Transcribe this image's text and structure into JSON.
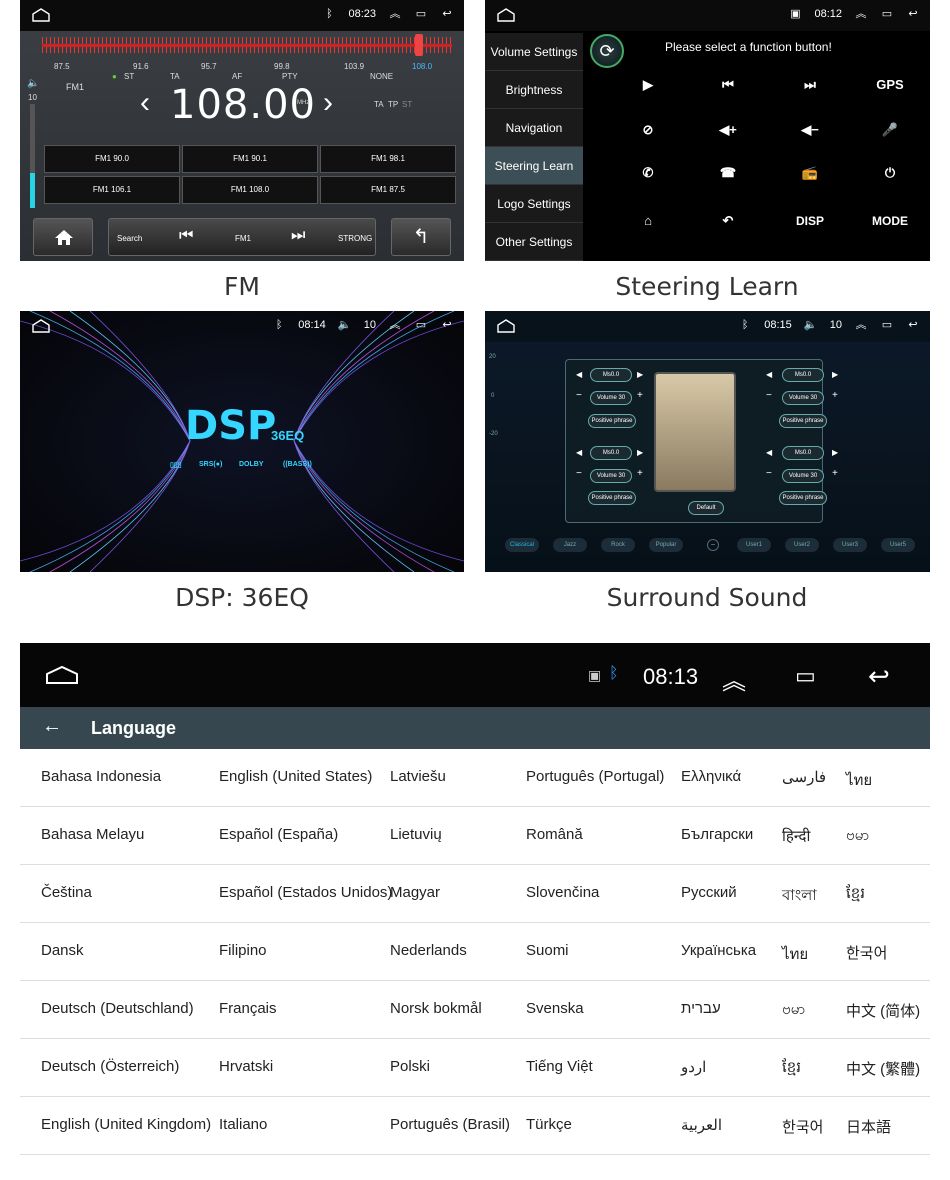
{
  "fm": {
    "time": "08:23",
    "scale_labels": [
      "87.5",
      "91.6",
      "95.7",
      "99.8",
      "103.9",
      "108.0"
    ],
    "indicators": [
      "ST",
      "TA",
      "AF",
      "PTY",
      "NONE"
    ],
    "band": "FM1",
    "volume": "10",
    "frequency": "108.00",
    "unit": "MHz",
    "ta_tp_st": [
      "TA",
      "TP",
      "ST"
    ],
    "presets": [
      "FM1 90.0",
      "FM1 90.1",
      "FM1 98.1",
      "FM1 106.1",
      "FM1 108.0",
      "FM1 87.5"
    ],
    "search_label": "Search",
    "band_label": "FM1",
    "strength_label": "STRONG",
    "caption": "FM"
  },
  "steer": {
    "time": "08:12",
    "prompt": "Please select a function button!",
    "menu": [
      "Volume Settings",
      "Brightness",
      "Navigation",
      "Steering Learn",
      "Logo Settings",
      "Other Settings"
    ],
    "selected": "Steering Learn",
    "text_buttons": {
      "gps": "GPS",
      "disp": "DISP",
      "mode": "MODE"
    },
    "caption": "Steering Learn"
  },
  "dsp": {
    "time": "08:14",
    "volume": "10",
    "title": "DSP",
    "subtitle": "36EQ",
    "badges": [
      "SRS(●)",
      "DOLBY",
      "((BASS))"
    ],
    "caption": "DSP: 36EQ"
  },
  "surround": {
    "time": "08:15",
    "volume": "10",
    "ms_label": "Ms0.0",
    "volume_label": "Volume 30",
    "phrase_label": "Positive phrase",
    "default_label": "Default",
    "y_ticks": [
      "20",
      "0",
      "-20"
    ],
    "modes": [
      "Classical",
      "Jazz",
      "Rock",
      "Popular",
      "User1",
      "User2",
      "User3",
      "User5"
    ],
    "caption": "Surround Sound"
  },
  "language": {
    "time": "08:13",
    "title": "Language",
    "rows": [
      [
        "Bahasa Indonesia",
        "English (United States)",
        "Latviešu",
        "Português (Portugal)",
        "Ελληνικά",
        "فارسی",
        "ไทย"
      ],
      [
        "Bahasa Melayu",
        "Español (España)",
        "Lietuvių",
        "Română",
        "Български",
        "हिन्दी",
        "ဗမာ"
      ],
      [
        "Čeština",
        "Español (Estados Unidos)",
        "Magyar",
        "Slovenčina",
        "Русский",
        "বাংলা",
        "ខ្មែរ"
      ],
      [
        "Dansk",
        "Filipino",
        "Nederlands",
        "Suomi",
        "Українська",
        "ไทย",
        "한국어"
      ],
      [
        "Deutsch (Deutschland)",
        "Français",
        "Norsk bokmål",
        "Svenska",
        "עברית",
        "ဗမာ",
        "中文 (简体)"
      ],
      [
        "Deutsch (Österreich)",
        "Hrvatski",
        "Polski",
        "Tiếng Việt",
        "اردو",
        "ខ្មែរ",
        "中文 (繁體)"
      ],
      [
        "English (United Kingdom)",
        "Italiano",
        "Português (Brasil)",
        "Türkçe",
        "العربية",
        "한국어",
        "日本語"
      ]
    ]
  }
}
